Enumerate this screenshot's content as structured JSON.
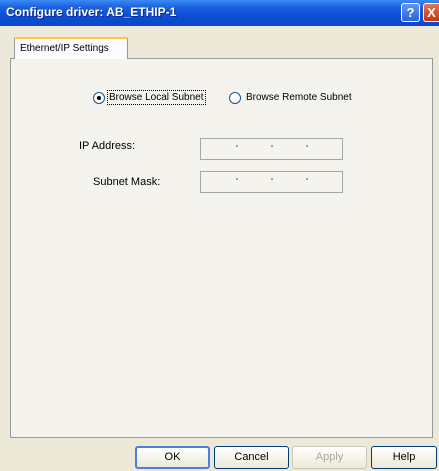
{
  "window": {
    "title": "Configure driver: AB_ETHIP-1",
    "help_glyph": "?",
    "close_glyph": "X"
  },
  "tabs": [
    {
      "label": "Ethernet/IP Settings",
      "selected": true
    }
  ],
  "browse_mode": {
    "options": [
      {
        "label": "Browse Local Subnet",
        "selected": true
      },
      {
        "label": "Browse Remote Subnet",
        "selected": false
      }
    ]
  },
  "fields": {
    "ip_address": {
      "label": "IP Address:",
      "value": "",
      "enabled": false
    },
    "subnet_mask": {
      "label": "Subnet Mask:",
      "value": "",
      "enabled": false
    }
  },
  "buttons": {
    "ok": "OK",
    "cancel": "Cancel",
    "apply": "Apply",
    "help": "Help"
  },
  "colors": {
    "titlebar": "#0a4fd6",
    "dialog_bg": "#ece9d8",
    "tab_accent": "#ffc73c"
  }
}
